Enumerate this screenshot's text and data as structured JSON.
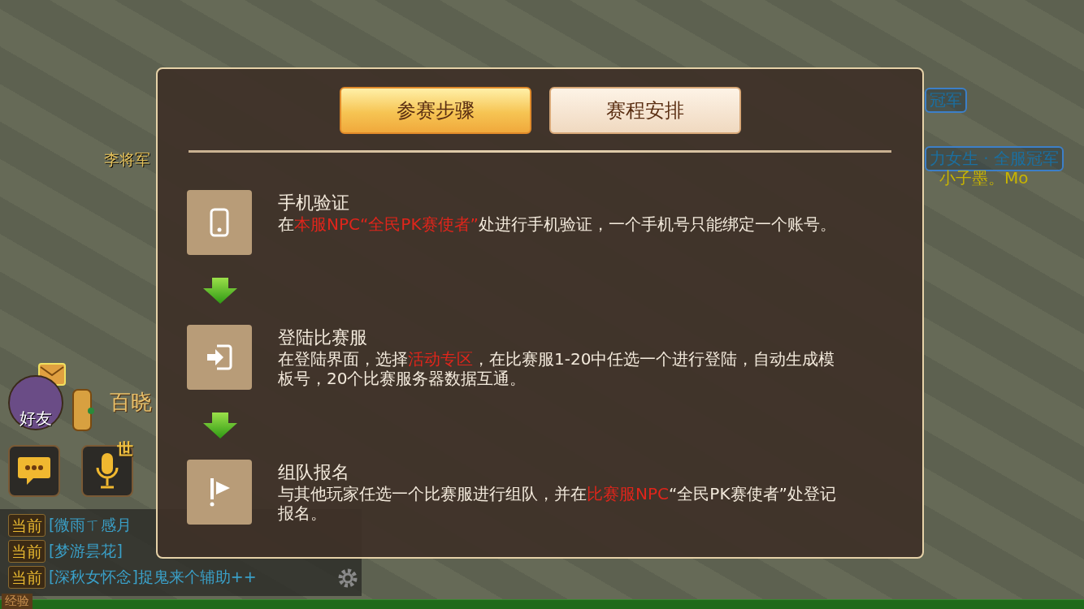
{
  "scene": {
    "labels": [
      {
        "kind": "npc",
        "text": "李将军"
      },
      {
        "kind": "title",
        "text": "冠军"
      },
      {
        "kind": "title",
        "text": "力女生 · 全服冠军"
      },
      {
        "kind": "player",
        "text": "小子墨。Mo"
      }
    ]
  },
  "hud": {
    "friends": {
      "label": "好友"
    },
    "script_label": "百晓",
    "voice_badge": "世",
    "chat": [
      {
        "channel": "当前",
        "message": "[微雨ㄒ感月"
      },
      {
        "channel": "当前",
        "message": "[梦游昙花]"
      },
      {
        "channel": "当前",
        "message": "[深秋女怀念]捉鬼来个辅助++"
      }
    ],
    "exp_label": "经验"
  },
  "dialog": {
    "tabs": [
      {
        "label": "参赛步骤",
        "selected": true
      },
      {
        "label": "赛程安排",
        "selected": false
      }
    ],
    "steps": [
      {
        "kind": "phone",
        "title": "手机验证",
        "desc": [
          {
            "text": "在",
            "highlight": false
          },
          {
            "text": "本服NPC“全民PK赛使者”",
            "highlight": true
          },
          {
            "text": "处进行手机验证，一个手机号只能绑定一个账号。",
            "highlight": false
          }
        ]
      },
      {
        "kind": "login",
        "title": "登陆比赛服",
        "desc": [
          {
            "text": "在登陆界面，选择",
            "highlight": false
          },
          {
            "text": "活动专区",
            "highlight": true
          },
          {
            "text": "，在比赛服1-20中任选一个进行登陆，自动生成模板号，20个比赛服务器数据互通。",
            "highlight": false
          }
        ]
      },
      {
        "kind": "flag",
        "title": "组队报名",
        "desc": [
          {
            "text": "与其他玩家任选一个比赛服进行组队，并在",
            "highlight": false
          },
          {
            "text": "比赛服NPC",
            "highlight": true
          },
          {
            "text": "“全民PK赛使者”处登记报名。",
            "highlight": false
          }
        ]
      }
    ]
  }
}
